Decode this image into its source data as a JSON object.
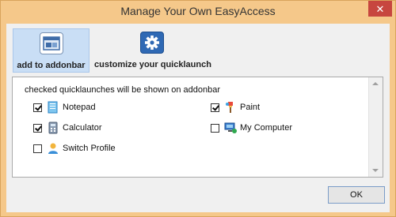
{
  "window": {
    "title": "Manage Your Own EasyAccess",
    "close_glyph": "✕",
    "accent_color": "#f5c88a",
    "close_color": "#c7463f"
  },
  "tabs": [
    {
      "label": "add to addonbar",
      "icon": "addonbar-icon",
      "selected": true
    },
    {
      "label": "customize your quicklaunch",
      "icon": "gear-icon",
      "selected": false
    }
  ],
  "panel": {
    "heading": "checked quicklaunches will be shown on addonbar",
    "items": [
      {
        "label": "Notepad",
        "checked": true,
        "icon": "notepad-icon"
      },
      {
        "label": "Paint",
        "checked": true,
        "icon": "paint-icon"
      },
      {
        "label": "Calculator",
        "checked": true,
        "icon": "calculator-icon"
      },
      {
        "label": "My Computer",
        "checked": false,
        "icon": "computer-icon"
      },
      {
        "label": "Switch Profile",
        "checked": false,
        "icon": "profile-icon"
      }
    ]
  },
  "buttons": {
    "ok": "OK"
  }
}
